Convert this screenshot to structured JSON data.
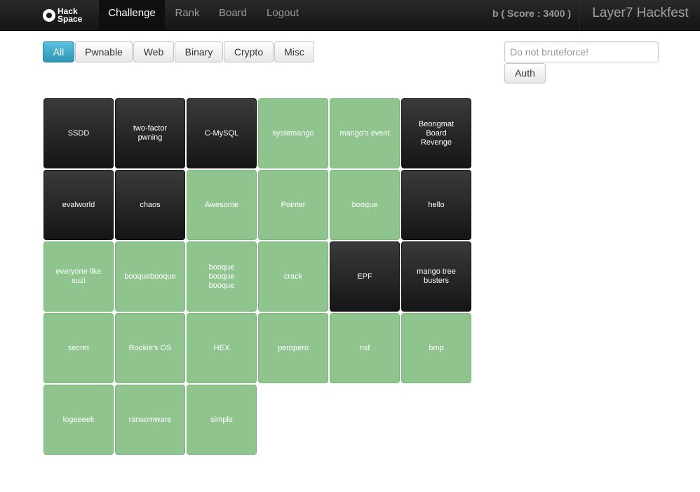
{
  "navbar": {
    "brand": {
      "line1": "Hack",
      "line2": "Space"
    },
    "items": [
      {
        "label": "Challenge",
        "active": true
      },
      {
        "label": "Rank",
        "active": false
      },
      {
        "label": "Board",
        "active": false
      },
      {
        "label": "Logout",
        "active": false
      }
    ],
    "score_text": "b ( Score : 3400 )",
    "site_title": "Layer7 Hackfest"
  },
  "filters": [
    "All",
    "Pwnable",
    "Web",
    "Binary",
    "Crypto",
    "Misc"
  ],
  "active_filter": "All",
  "auth": {
    "placeholder": "Do not bruteforce!",
    "button_label": "Auth"
  },
  "colors": {
    "solved": "#8fc48f",
    "unsolved": "#1f1f1f",
    "active_filter": "#49afcd"
  },
  "challenges": [
    {
      "name": "SSDD",
      "solved": false
    },
    {
      "name": "two-factor pwning",
      "solved": false
    },
    {
      "name": "C-MySQL",
      "solved": false
    },
    {
      "name": "systemango",
      "solved": true
    },
    {
      "name": "mango's event",
      "solved": true
    },
    {
      "name": "Beongmat Board Revenge",
      "solved": false
    },
    {
      "name": "evalworld",
      "solved": false
    },
    {
      "name": "chaos",
      "solved": false
    },
    {
      "name": "Awesome",
      "solved": true
    },
    {
      "name": "Pointer",
      "solved": true
    },
    {
      "name": "booque",
      "solved": true
    },
    {
      "name": "hello",
      "solved": false
    },
    {
      "name": "everyone like suzi",
      "solved": true
    },
    {
      "name": "booquebooque",
      "solved": true
    },
    {
      "name": "booque booque booque",
      "solved": true
    },
    {
      "name": "crack",
      "solved": true
    },
    {
      "name": "EPF",
      "solved": false
    },
    {
      "name": "mango tree busters",
      "solved": false
    },
    {
      "name": "secret",
      "solved": true
    },
    {
      "name": "Rookie's OS",
      "solved": true
    },
    {
      "name": "HEX",
      "solved": true
    },
    {
      "name": "peropero",
      "solved": true
    },
    {
      "name": "nsf",
      "solved": true
    },
    {
      "name": "bmp",
      "solved": true
    },
    {
      "name": "logeeeek",
      "solved": true
    },
    {
      "name": "ransomware",
      "solved": true
    },
    {
      "name": "simple",
      "solved": true
    }
  ]
}
